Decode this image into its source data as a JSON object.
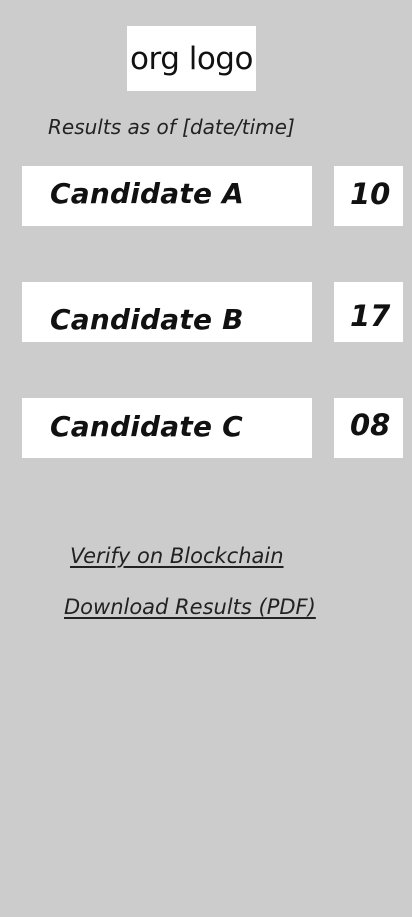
{
  "header": {
    "logo_text": "org logo",
    "results_timestamp": "Results as of [date/time]"
  },
  "results": [
    {
      "name": "Candidate A",
      "votes": "10"
    },
    {
      "name": "Candidate B",
      "votes": "17"
    },
    {
      "name": "Candidate C",
      "votes": "08"
    }
  ],
  "links": {
    "verify_label": "Verify on Blockchain",
    "download_label": "Download Results (PDF)"
  },
  "colors": {
    "background": "#cccccc",
    "card_background": "#ffffff",
    "text": "#111111"
  }
}
